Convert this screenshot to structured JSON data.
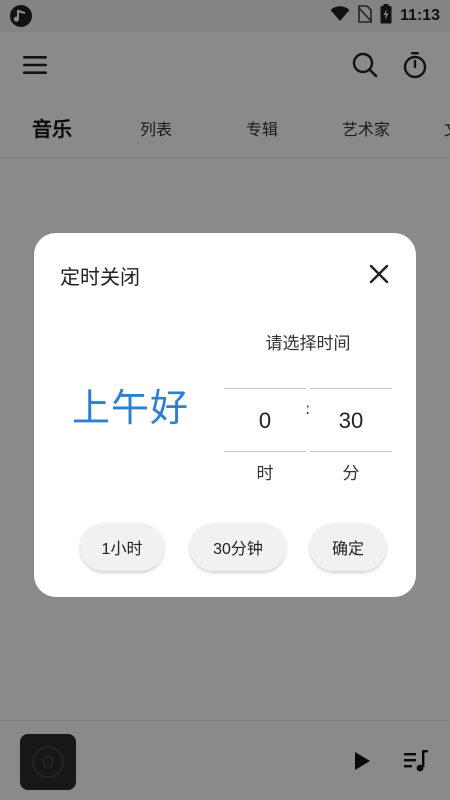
{
  "statusbar": {
    "time": "11:13"
  },
  "tabs": [
    "音乐",
    "列表",
    "专辑",
    "艺术家",
    "文"
  ],
  "dialog": {
    "title": "定时关闭",
    "prompt": "请选择时间",
    "greeting": "上午好",
    "hour_value": "0",
    "minute_value": "30",
    "separator": ":",
    "hour_unit": "时",
    "minute_unit": "分",
    "buttons": [
      "1小时",
      "30分钟",
      "确定"
    ]
  },
  "colors": {
    "accent": "#2e7fd1",
    "scrim": "#8a8a8a"
  },
  "icons": [
    "music-app-icon",
    "wifi-icon",
    "no-sim-icon",
    "battery-icon",
    "menu-icon",
    "search-icon",
    "timer-icon",
    "close-icon",
    "album-cover-icon",
    "play-icon",
    "playlist-icon"
  ]
}
